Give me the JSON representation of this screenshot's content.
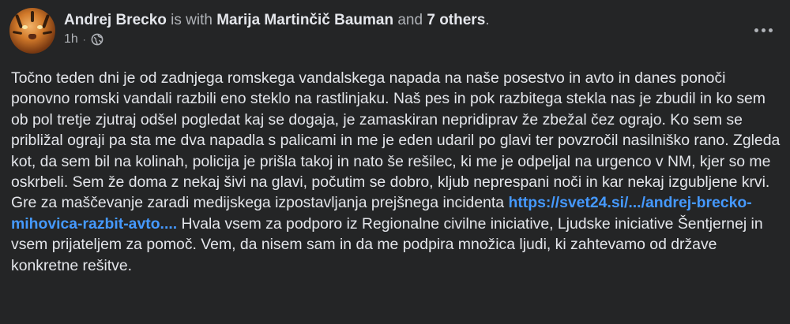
{
  "post": {
    "author": "Andrej Brecko",
    "with_text": "is with",
    "tagged_person": "Marija Martinčič Bauman",
    "and_text": "and",
    "others": "7 others",
    "period": ".",
    "time": "1h",
    "separator": "·",
    "privacy_icon": "globe-icon",
    "more_icon": "more-options-icon",
    "body_part1": "Točno teden dni je od zadnjega romskega vandalskega napada na naše posestvo in avto in danes ponoči ponovno romski vandali razbili eno steklo na rastlinjaku. Naš pes in pok razbitega stekla nas je zbudil in ko sem ob pol tretje zjutraj odšel pogledat kaj se dogaja, je zamaskiran nepridiprav že zbežal čez ograjo. Ko sem se približal ograji pa sta me dva napadla s palicami in me je eden udaril po glavi ter povzročil nasilniško rano. Zgleda kot, da sem bil na kolinah, policija je prišla takoj in nato še rešilec, ki me je odpeljal na urgenco v NM, kjer so me oskrbeli. Sem že doma z nekaj šivi na glavi, počutim se dobro, kljub neprespani noči in kar nekaj izgubljene krvi. Gre za maščevanje zaradi medijskega izpostavljanja prejšnega incidenta ",
    "link_text": "https://svet24.si/.../andrej-brecko-mihovica-razbit-avto....",
    "body_part2": " Hvala vsem za podporo iz Regionalne civilne iniciative, Ljudske iniciative Šentjernej in vsem prijateljem za pomoč. Vem, da nisem sam in da me podpira množica ljudi, ki zahtevamo od države konkretne rešitve."
  },
  "colors": {
    "background": "#242526",
    "primary_text": "#e4e6eb",
    "secondary_text": "#b0b3b8",
    "link": "#4599ff"
  }
}
